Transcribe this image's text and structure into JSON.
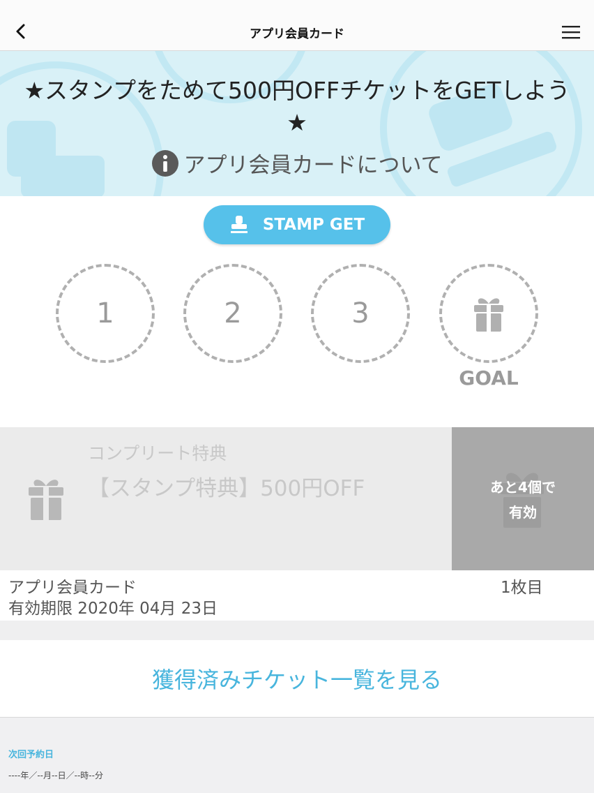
{
  "nav": {
    "title": "アプリ会員カード",
    "back_icon": "chevron-left-icon",
    "menu_icon": "hamburger-menu-icon"
  },
  "banner": {
    "headline": "★スタンプをためて500円OFFチケットをGETしよう★",
    "about_link": "アプリ会員カードについて",
    "about_icon": "info-icon",
    "bg_color": "#d9f1f7"
  },
  "stamp_button": {
    "label": "STAMP GET",
    "icon": "stamp-icon",
    "color": "#56c1ea"
  },
  "stamps": {
    "slots": [
      "1",
      "2",
      "3"
    ],
    "goal_icon": "gift-icon",
    "goal_label": "GOAL",
    "collected": 0
  },
  "reward": {
    "subtitle": "コンプリート特典",
    "title": "【スタンプ特典】500円OFF",
    "icon": "gift-icon",
    "remaining_line1": "あと4個で",
    "remaining_line2": "有効"
  },
  "card": {
    "name": "アプリ会員カード",
    "count": "1枚目",
    "expiry": "有効期限 2020年 04月 23日"
  },
  "tickets_link": {
    "label": "獲得済みチケット一覧を見る",
    "color": "#48b5dd"
  },
  "next_reservation": {
    "label": "次回予約日",
    "value": "----年／--月--日／--時--分"
  }
}
